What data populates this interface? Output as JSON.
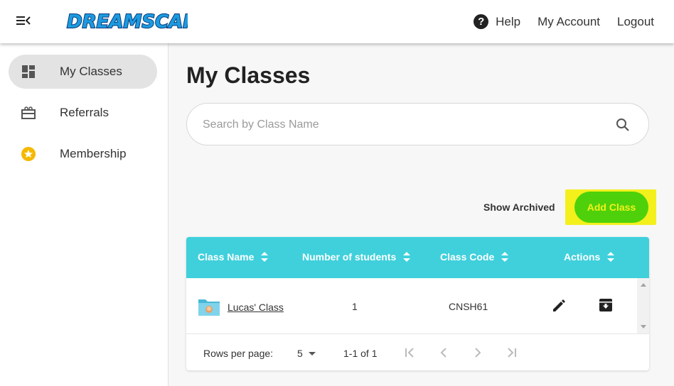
{
  "header": {
    "logo_text": "DREAMSCAPE",
    "help_label": "Help",
    "account_label": "My Account",
    "logout_label": "Logout"
  },
  "sidebar": {
    "items": [
      {
        "label": "My Classes",
        "icon": "dashboard-icon",
        "active": true
      },
      {
        "label": "Referrals",
        "icon": "gift-icon",
        "active": false
      },
      {
        "label": "Membership",
        "icon": "star-badge-icon",
        "active": false
      }
    ]
  },
  "main": {
    "title": "My Classes",
    "search_placeholder": "Search by Class Name",
    "show_archived_label": "Show Archived",
    "add_class_label": "Add Class"
  },
  "table": {
    "columns": [
      "Class Name",
      "Number of students",
      "Class Code",
      "Actions"
    ],
    "rows": [
      {
        "class_name": "Lucas' Class",
        "students": "1",
        "class_code": "CNSH61"
      }
    ],
    "footer": {
      "rows_per_page_label": "Rows per page:",
      "rows_per_page_value": "5",
      "range_text": "1-1 of 1"
    }
  },
  "colors": {
    "table_header": "#3fd0dc",
    "add_button": "#4ed10a",
    "add_button_text": "#f3f01c",
    "highlight": "#f3f01c",
    "membership_star": "#f5b800"
  }
}
